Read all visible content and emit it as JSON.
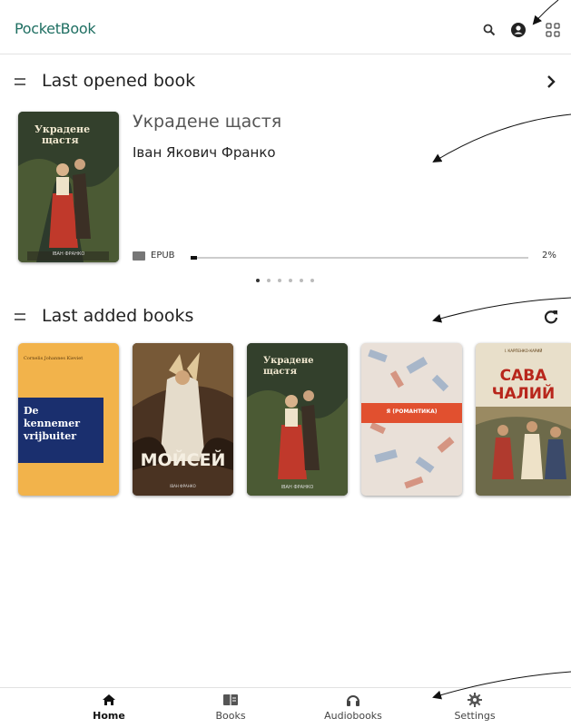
{
  "app": {
    "logo": "PocketBook"
  },
  "header": {
    "icons": [
      "search-icon",
      "account-icon",
      "apps-grid-icon"
    ]
  },
  "last_opened": {
    "section_title": "Last opened book",
    "book": {
      "cover_lines": [
        "Украдене",
        "щастя"
      ],
      "cover_author": "ІВАН ФРАНКО",
      "title": "Украдене щастя",
      "author": "Іван Якович Франко",
      "format": "EPUB",
      "progress_percent": 2,
      "progress_label": "2%"
    },
    "carousel": {
      "pages": 6,
      "active": 0
    }
  },
  "last_added": {
    "section_title": "Last added books",
    "books": [
      {
        "cover_author": "Cornelis Johannes Kieviet",
        "cover_title": "De kennemer vrijbuiter"
      },
      {
        "cover_title": "МОЙСЕЙ",
        "cover_author": "ІВАН ФРАНКО"
      },
      {
        "cover_title": "Украдене щастя",
        "cover_author": "ІВАН ФРАНКО"
      },
      {
        "cover_title": "Я (РОМАНТИКА)"
      },
      {
        "cover_author": "І. КАРПЕНКО-КАРИЙ",
        "cover_title": "САВА ЧАЛИЙ"
      }
    ]
  },
  "bottom_nav": {
    "items": [
      {
        "label": "Home",
        "icon": "home-icon",
        "active": true
      },
      {
        "label": "Books",
        "icon": "books-icon",
        "active": false
      },
      {
        "label": "Audiobooks",
        "icon": "headphones-icon",
        "active": false
      },
      {
        "label": "Settings",
        "icon": "gear-icon",
        "active": false
      }
    ]
  },
  "colors": {
    "brand": "#1f6f62",
    "cover1_bg": "#f2b34b",
    "cover1_box": "#1a2f6e",
    "cover4_band": "#e1502f"
  }
}
